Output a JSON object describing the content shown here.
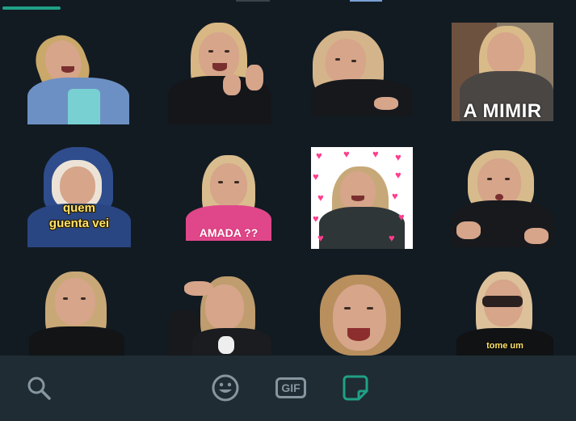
{
  "tray": {
    "stickers": [
      {
        "name": "sticker-denim-laugh",
        "caption": ""
      },
      {
        "name": "sticker-thumbs-up",
        "caption": ""
      },
      {
        "name": "sticker-hand-on-cheek",
        "caption": ""
      },
      {
        "name": "sticker-a-mimir",
        "caption": "A MIMIR"
      },
      {
        "name": "sticker-quem-guenta",
        "caption": "quem\nguenta vei"
      },
      {
        "name": "sticker-amada",
        "caption": "AMADA ??"
      },
      {
        "name": "sticker-hearts",
        "caption": ""
      },
      {
        "name": "sticker-pout",
        "caption": ""
      },
      {
        "name": "sticker-arms-crossed",
        "caption": ""
      },
      {
        "name": "sticker-hand-on-head",
        "caption": ""
      },
      {
        "name": "sticker-big-smile",
        "caption": ""
      },
      {
        "name": "sticker-tome-um",
        "caption": "tome um"
      }
    ]
  },
  "bottom_bar": {
    "search_icon": "search-icon",
    "emoji_icon": "emoji-icon",
    "gif_label": "GIF",
    "sticker_icon": "sticker-icon"
  },
  "colors": {
    "background": "#121b22",
    "bar": "#1f2c33",
    "accent": "#20a186",
    "icon_gray": "#8696a0"
  }
}
